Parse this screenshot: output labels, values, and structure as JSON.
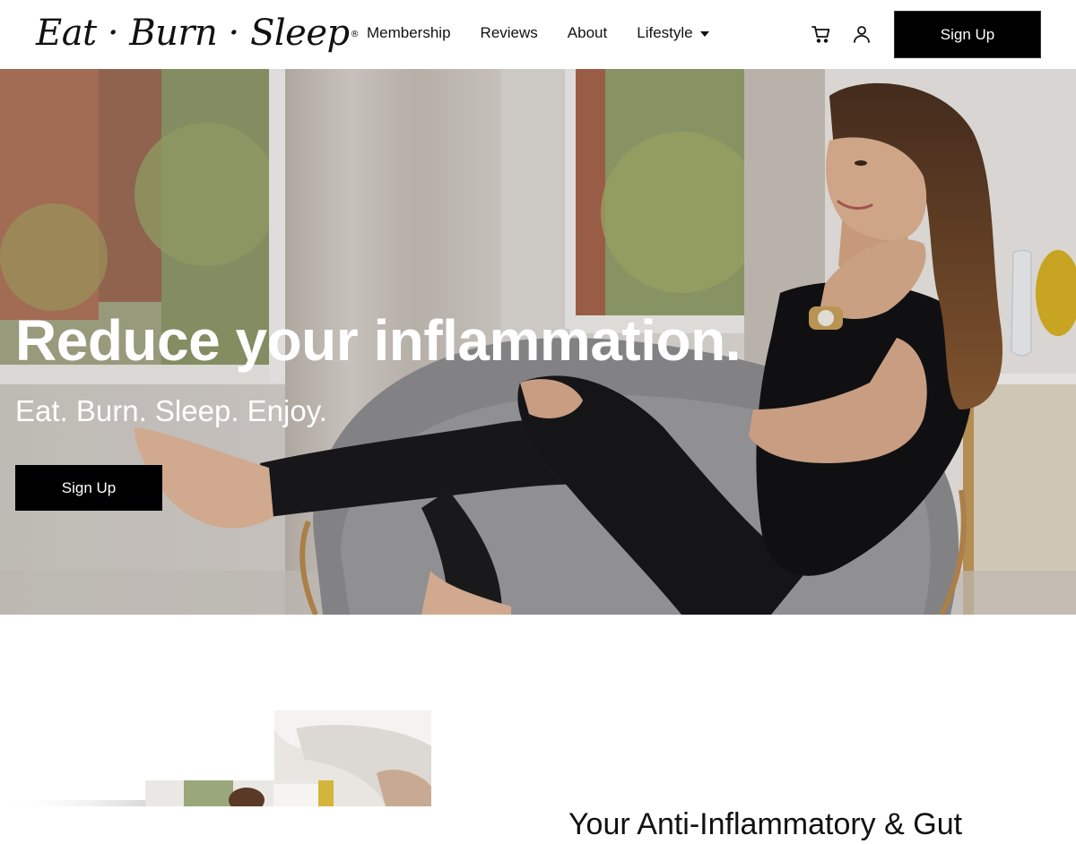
{
  "header": {
    "logo_text": "Eat · Burn · Sleep",
    "logo_mark": "®",
    "nav": {
      "membership": "Membership",
      "reviews": "Reviews",
      "about": "About",
      "lifestyle": "Lifestyle"
    },
    "icons": {
      "cart": "cart-icon",
      "user": "user-icon",
      "dropdown": "caret-down-icon"
    },
    "signup_label": "Sign Up"
  },
  "hero": {
    "title": "Reduce your inflammation.",
    "subtitle": "Eat. Burn. Sleep. Enjoy.",
    "signup_label": "Sign Up"
  },
  "section": {
    "heading": "Your Anti-Inflammatory & Gut"
  },
  "colors": {
    "button_bg": "#000000",
    "button_text": "#ffffff",
    "text": "#111111",
    "hero_text": "#ffffff"
  }
}
